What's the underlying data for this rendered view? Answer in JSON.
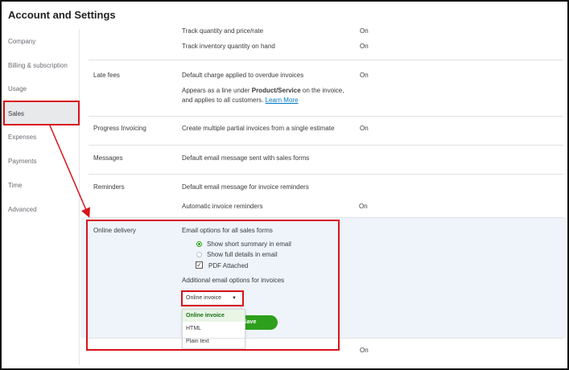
{
  "title": "Account and Settings",
  "sidebar": {
    "items": [
      {
        "label": "Company"
      },
      {
        "label": "Billing & subscription"
      },
      {
        "label": "Usage"
      },
      {
        "label": "Sales"
      },
      {
        "label": "Expenses"
      },
      {
        "label": "Payments"
      },
      {
        "label": "Time"
      },
      {
        "label": "Advanced"
      }
    ]
  },
  "products": {
    "track_qty": "Track quantity and price/rate",
    "track_qty_state": "On",
    "track_inv": "Track inventory quantity on hand",
    "track_inv_state": "On"
  },
  "late_fees": {
    "label": "Late fees",
    "line1": "Default charge applied to overdue invoices",
    "state": "On",
    "line2_pre": "Appears as a line under ",
    "line2_bold": "Product/Service",
    "line2_post": " on the invoice,",
    "line3": "and applies to all customers.",
    "learn_more": "Learn More"
  },
  "progress": {
    "label": "Progress Invoicing",
    "desc": "Create multiple partial invoices from a single estimate",
    "state": "On"
  },
  "messages": {
    "label": "Messages",
    "desc": "Default email message sent with sales forms"
  },
  "reminders": {
    "label": "Reminders",
    "desc": "Default email message for invoice reminders",
    "auto": "Automatic invoice reminders",
    "auto_state": "On"
  },
  "online_delivery": {
    "label": "Online delivery",
    "email_options": "Email options for all sales forms",
    "opt_summary": "Show short summary in email",
    "opt_full": "Show full details in email",
    "pdf": "PDF Attached",
    "additional": "Additional email options for invoices",
    "select_value": "Online invoice",
    "dropdown": [
      "Online invoice",
      "HTML",
      "Plain text"
    ],
    "save": "Save"
  },
  "statements": {
    "state": "On"
  },
  "colors": {
    "accent": "#2ca01c",
    "annotation": "#d8121b",
    "link": "#0077c5"
  }
}
